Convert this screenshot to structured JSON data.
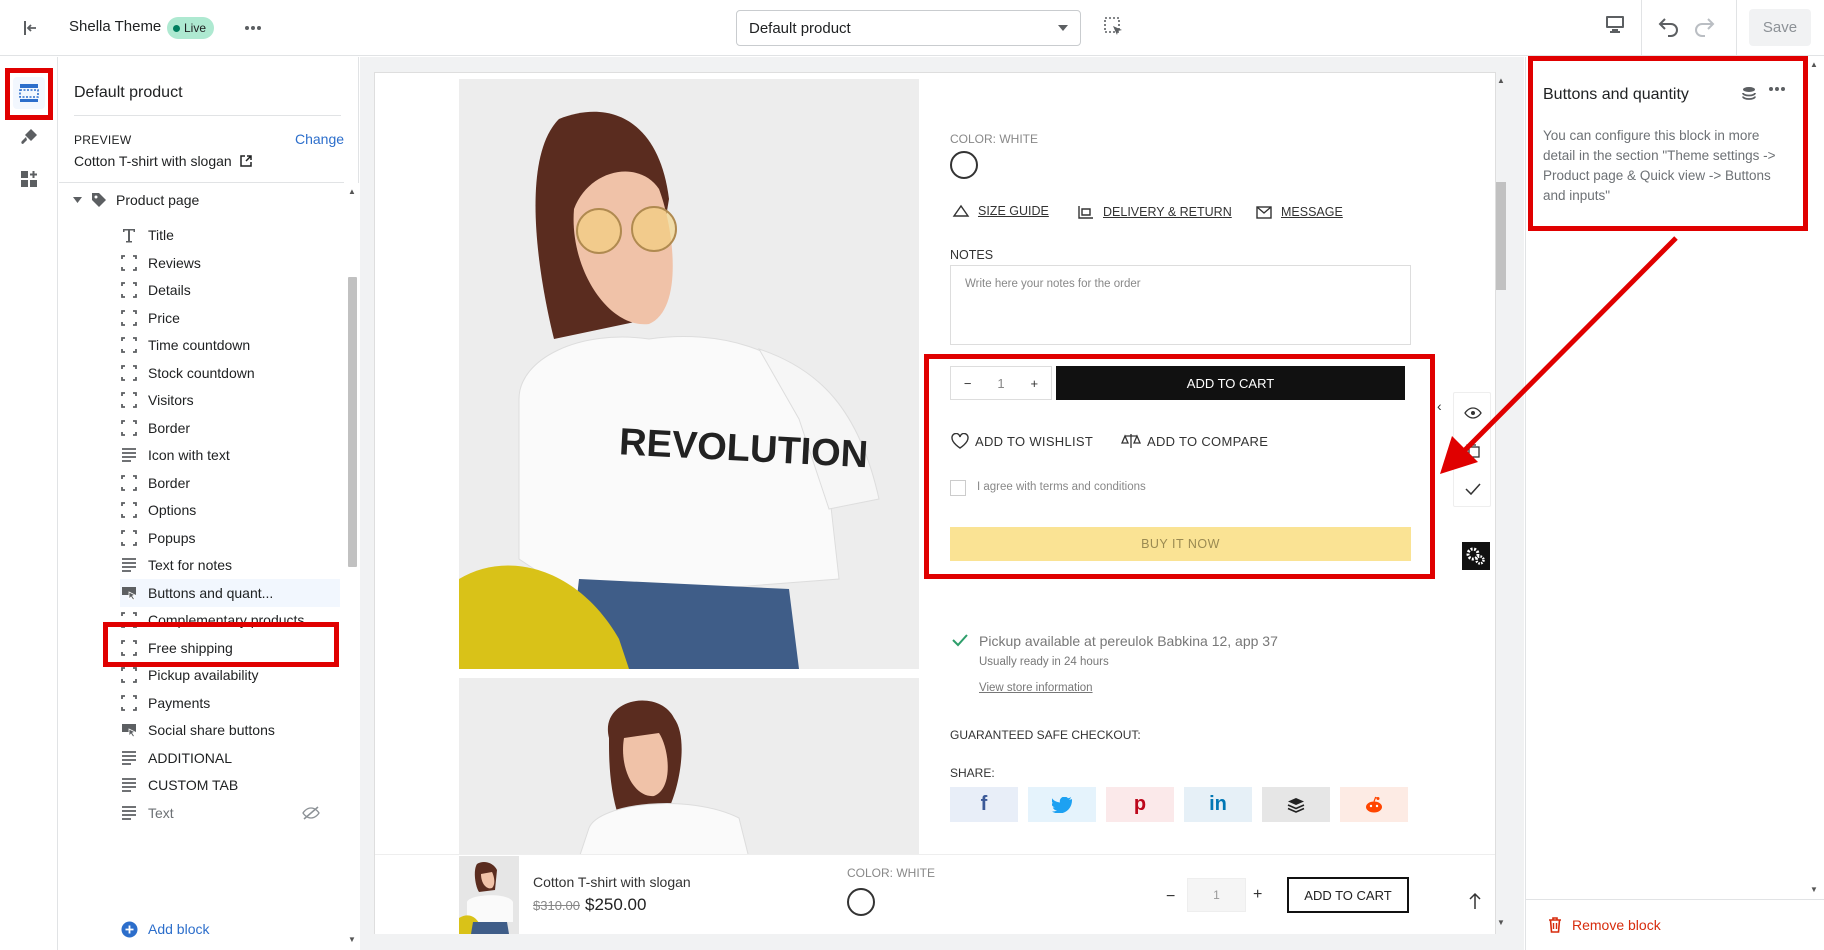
{
  "topbar": {
    "theme_name": "Shella Theme",
    "live_label": "Live",
    "template_select": "Default product",
    "save_label": "Save"
  },
  "sidebar": {
    "title": "Default product",
    "preview_label": "PREVIEW",
    "preview_change": "Change",
    "preview_value": "Cotton T-shirt with slogan",
    "section_name": "Product page",
    "items": [
      {
        "label": "Title",
        "icon": "text-icon"
      },
      {
        "label": "Reviews",
        "icon": "block-icon"
      },
      {
        "label": "Details",
        "icon": "block-icon"
      },
      {
        "label": "Price",
        "icon": "block-icon"
      },
      {
        "label": "Time countdown",
        "icon": "block-icon"
      },
      {
        "label": "Stock countdown",
        "icon": "block-icon"
      },
      {
        "label": "Visitors",
        "icon": "block-icon"
      },
      {
        "label": "Border",
        "icon": "block-icon"
      },
      {
        "label": "Icon with text",
        "icon": "lines-icon"
      },
      {
        "label": "Border",
        "icon": "block-icon"
      },
      {
        "label": "Options",
        "icon": "block-icon"
      },
      {
        "label": "Popups",
        "icon": "block-icon"
      },
      {
        "label": "Text for notes",
        "icon": "lines-icon"
      },
      {
        "label": "Buttons and quant...",
        "icon": "buttons-icon"
      },
      {
        "label": "Complementary products",
        "icon": "block-icon"
      },
      {
        "label": "Free shipping",
        "icon": "block-icon"
      },
      {
        "label": "Pickup availability",
        "icon": "block-icon"
      },
      {
        "label": "Payments",
        "icon": "block-icon"
      },
      {
        "label": "Social share buttons",
        "icon": "buttons-icon"
      },
      {
        "label": "ADDITIONAL",
        "icon": "lines-icon"
      },
      {
        "label": "CUSTOM TAB",
        "icon": "lines-icon"
      },
      {
        "label": "Text",
        "icon": "lines-icon"
      }
    ],
    "add_block": "Add block"
  },
  "preview": {
    "color_label": "COLOR: WHITE",
    "size_guide": "SIZE GUIDE",
    "delivery_return": "DELIVERY & RETURN",
    "message": "MESSAGE",
    "notes_label": "NOTES",
    "notes_placeholder": "Write here your notes for the order",
    "qty_minus": "−",
    "qty_value": "1",
    "qty_plus": "+",
    "add_to_cart": "ADD TO CART",
    "add_to_wishlist": "ADD TO WISHLIST",
    "add_to_compare": "ADD TO COMPARE",
    "terms": "I agree with terms and conditions",
    "buy_now": "BUY IT NOW",
    "pickup": "Pickup available at pereulok Babkina 12, app 37",
    "pickup_sub": "Usually ready in 24 hours",
    "store_link": "View store information",
    "guaranteed": "GUARANTEED SAFE CHECKOUT:",
    "share_label": "SHARE:",
    "tshirt_print": "REVOLUTION",
    "sticky": {
      "title": "Cotton T-shirt with slogan",
      "old_price": "$310.00",
      "new_price": "$250.00",
      "color_label": "COLOR: WHITE",
      "qty_value": "1",
      "add_to_cart": "ADD TO CART"
    }
  },
  "right_panel": {
    "title": "Buttons and quantity",
    "description": "You can configure this block in more detail in the section \"Theme settings -> Product page & Quick view -> Buttons and inputs\"",
    "remove_block": "Remove block"
  },
  "colors": {
    "accent": "#2c6ecb",
    "highlight": "#e00000",
    "buy_now_bg": "#fae394",
    "danger": "#d72c0d"
  }
}
